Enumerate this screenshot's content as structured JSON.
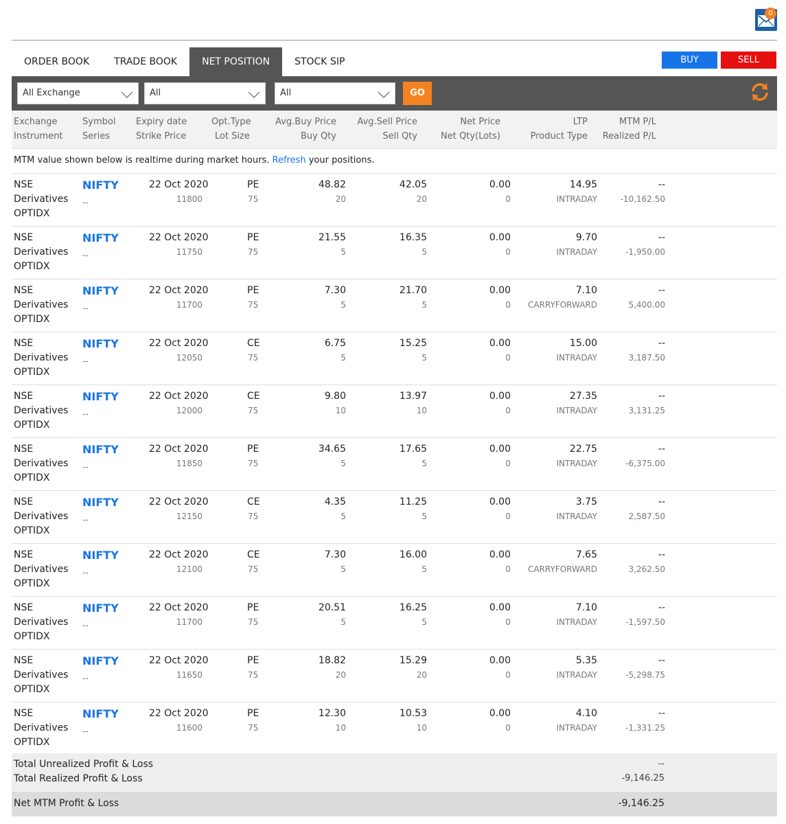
{
  "header": {
    "mail_badge": "0"
  },
  "tabs": [
    {
      "label": "ORDER BOOK"
    },
    {
      "label": "TRADE BOOK"
    },
    {
      "label": "NET POSITION"
    },
    {
      "label": "STOCK SIP"
    }
  ],
  "active_tab": "NET POSITION",
  "actions": {
    "buy": "BUY",
    "sell": "SELL"
  },
  "filters": {
    "exchange": "All Exchange",
    "filter2": "All",
    "filter3": "All",
    "go": "GO"
  },
  "columns": {
    "exchange": "Exchange",
    "instrument": "Instrument",
    "symbol": "Symbol",
    "series": "Series",
    "expiry": "Expiry date",
    "strike": "Strike Price",
    "opt_type": "Opt.Type",
    "lot_size": "Lot Size",
    "avg_buy": "Avg.Buy Price",
    "buy_qty": "Buy Qty",
    "avg_sell": "Avg.Sell Price",
    "sell_qty": "Sell Qty",
    "net_price": "Net Price",
    "net_qty": "Net Qty(Lots)",
    "ltp": "LTP",
    "product_type": "Product Type",
    "mtm": "MTM P/L",
    "realized": "Realized P/L"
  },
  "notice": {
    "prefix": "MTM value shown below is realtime during market hours. ",
    "link": "Refresh",
    "suffix": " your positions."
  },
  "positions": [
    {
      "exchange": "NSE",
      "segment": "Derivatives",
      "instrument": "OPTIDX",
      "symbol": "NIFTY",
      "series": "--",
      "expiry": "22 Oct 2020",
      "strike": "11800",
      "opt_type": "PE",
      "lot_size": "75",
      "avg_buy": "48.82",
      "buy_qty": "20",
      "avg_sell": "42.05",
      "sell_qty": "20",
      "net_price": "0.00",
      "net_qty": "0",
      "ltp": "14.95",
      "product": "INTRADAY",
      "mtm": "--",
      "realized": "-10,162.50"
    },
    {
      "exchange": "NSE",
      "segment": "Derivatives",
      "instrument": "OPTIDX",
      "symbol": "NIFTY",
      "series": "--",
      "expiry": "22 Oct 2020",
      "strike": "11750",
      "opt_type": "PE",
      "lot_size": "75",
      "avg_buy": "21.55",
      "buy_qty": "5",
      "avg_sell": "16.35",
      "sell_qty": "5",
      "net_price": "0.00",
      "net_qty": "0",
      "ltp": "9.70",
      "product": "INTRADAY",
      "mtm": "--",
      "realized": "-1,950.00"
    },
    {
      "exchange": "NSE",
      "segment": "Derivatives",
      "instrument": "OPTIDX",
      "symbol": "NIFTY",
      "series": "--",
      "expiry": "22 Oct 2020",
      "strike": "11700",
      "opt_type": "PE",
      "lot_size": "75",
      "avg_buy": "7.30",
      "buy_qty": "5",
      "avg_sell": "21.70",
      "sell_qty": "5",
      "net_price": "0.00",
      "net_qty": "0",
      "ltp": "7.10",
      "product": "CARRYFORWARD",
      "mtm": "--",
      "realized": "5,400.00"
    },
    {
      "exchange": "NSE",
      "segment": "Derivatives",
      "instrument": "OPTIDX",
      "symbol": "NIFTY",
      "series": "--",
      "expiry": "22 Oct 2020",
      "strike": "12050",
      "opt_type": "CE",
      "lot_size": "75",
      "avg_buy": "6.75",
      "buy_qty": "5",
      "avg_sell": "15.25",
      "sell_qty": "5",
      "net_price": "0.00",
      "net_qty": "0",
      "ltp": "15.00",
      "product": "INTRADAY",
      "mtm": "--",
      "realized": "3,187.50"
    },
    {
      "exchange": "NSE",
      "segment": "Derivatives",
      "instrument": "OPTIDX",
      "symbol": "NIFTY",
      "series": "--",
      "expiry": "22 Oct 2020",
      "strike": "12000",
      "opt_type": "CE",
      "lot_size": "75",
      "avg_buy": "9.80",
      "buy_qty": "10",
      "avg_sell": "13.97",
      "sell_qty": "10",
      "net_price": "0.00",
      "net_qty": "0",
      "ltp": "27.35",
      "product": "INTRADAY",
      "mtm": "--",
      "realized": "3,131.25"
    },
    {
      "exchange": "NSE",
      "segment": "Derivatives",
      "instrument": "OPTIDX",
      "symbol": "NIFTY",
      "series": "--",
      "expiry": "22 Oct 2020",
      "strike": "11850",
      "opt_type": "PE",
      "lot_size": "75",
      "avg_buy": "34.65",
      "buy_qty": "5",
      "avg_sell": "17.65",
      "sell_qty": "5",
      "net_price": "0.00",
      "net_qty": "0",
      "ltp": "22.75",
      "product": "INTRADAY",
      "mtm": "--",
      "realized": "-6,375.00"
    },
    {
      "exchange": "NSE",
      "segment": "Derivatives",
      "instrument": "OPTIDX",
      "symbol": "NIFTY",
      "series": "--",
      "expiry": "22 Oct 2020",
      "strike": "12150",
      "opt_type": "CE",
      "lot_size": "75",
      "avg_buy": "4.35",
      "buy_qty": "5",
      "avg_sell": "11.25",
      "sell_qty": "5",
      "net_price": "0.00",
      "net_qty": "0",
      "ltp": "3.75",
      "product": "INTRADAY",
      "mtm": "--",
      "realized": "2,587.50"
    },
    {
      "exchange": "NSE",
      "segment": "Derivatives",
      "instrument": "OPTIDX",
      "symbol": "NIFTY",
      "series": "--",
      "expiry": "22 Oct 2020",
      "strike": "12100",
      "opt_type": "CE",
      "lot_size": "75",
      "avg_buy": "7.30",
      "buy_qty": "5",
      "avg_sell": "16.00",
      "sell_qty": "5",
      "net_price": "0.00",
      "net_qty": "0",
      "ltp": "7.65",
      "product": "CARRYFORWARD",
      "mtm": "--",
      "realized": "3,262.50"
    },
    {
      "exchange": "NSE",
      "segment": "Derivatives",
      "instrument": "OPTIDX",
      "symbol": "NIFTY",
      "series": "--",
      "expiry": "22 Oct 2020",
      "strike": "11700",
      "opt_type": "PE",
      "lot_size": "75",
      "avg_buy": "20.51",
      "buy_qty": "5",
      "avg_sell": "16.25",
      "sell_qty": "5",
      "net_price": "0.00",
      "net_qty": "0",
      "ltp": "7.10",
      "product": "INTRADAY",
      "mtm": "--",
      "realized": "-1,597.50"
    },
    {
      "exchange": "NSE",
      "segment": "Derivatives",
      "instrument": "OPTIDX",
      "symbol": "NIFTY",
      "series": "--",
      "expiry": "22 Oct 2020",
      "strike": "11650",
      "opt_type": "PE",
      "lot_size": "75",
      "avg_buy": "18.82",
      "buy_qty": "20",
      "avg_sell": "15.29",
      "sell_qty": "20",
      "net_price": "0.00",
      "net_qty": "0",
      "ltp": "5.35",
      "product": "INTRADAY",
      "mtm": "--",
      "realized": "-5,298.75"
    },
    {
      "exchange": "NSE",
      "segment": "Derivatives",
      "instrument": "OPTIDX",
      "symbol": "NIFTY",
      "series": "--",
      "expiry": "22 Oct 2020",
      "strike": "11600",
      "opt_type": "PE",
      "lot_size": "75",
      "avg_buy": "12.30",
      "buy_qty": "10",
      "avg_sell": "10.53",
      "sell_qty": "10",
      "net_price": "0.00",
      "net_qty": "0",
      "ltp": "4.10",
      "product": "INTRADAY",
      "mtm": "--",
      "realized": "-1,331.25"
    }
  ],
  "totals": {
    "unrealized_label": "Total Unrealized Profit & Loss",
    "unrealized_value": "--",
    "realized_label": "Total Realized Profit & Loss",
    "realized_value": "-9,146.25",
    "net_label": "Net MTM Profit & Loss",
    "net_value": "-9,146.25"
  },
  "colors": {
    "accent_blue": "#1774e8",
    "sell_red": "#e51010",
    "go_orange": "#f58220",
    "toolbar_grey": "#555555"
  },
  "icons": {
    "mail": "mail-icon",
    "refresh": "refresh-icon",
    "dropdown": "chevron-down-icon"
  }
}
